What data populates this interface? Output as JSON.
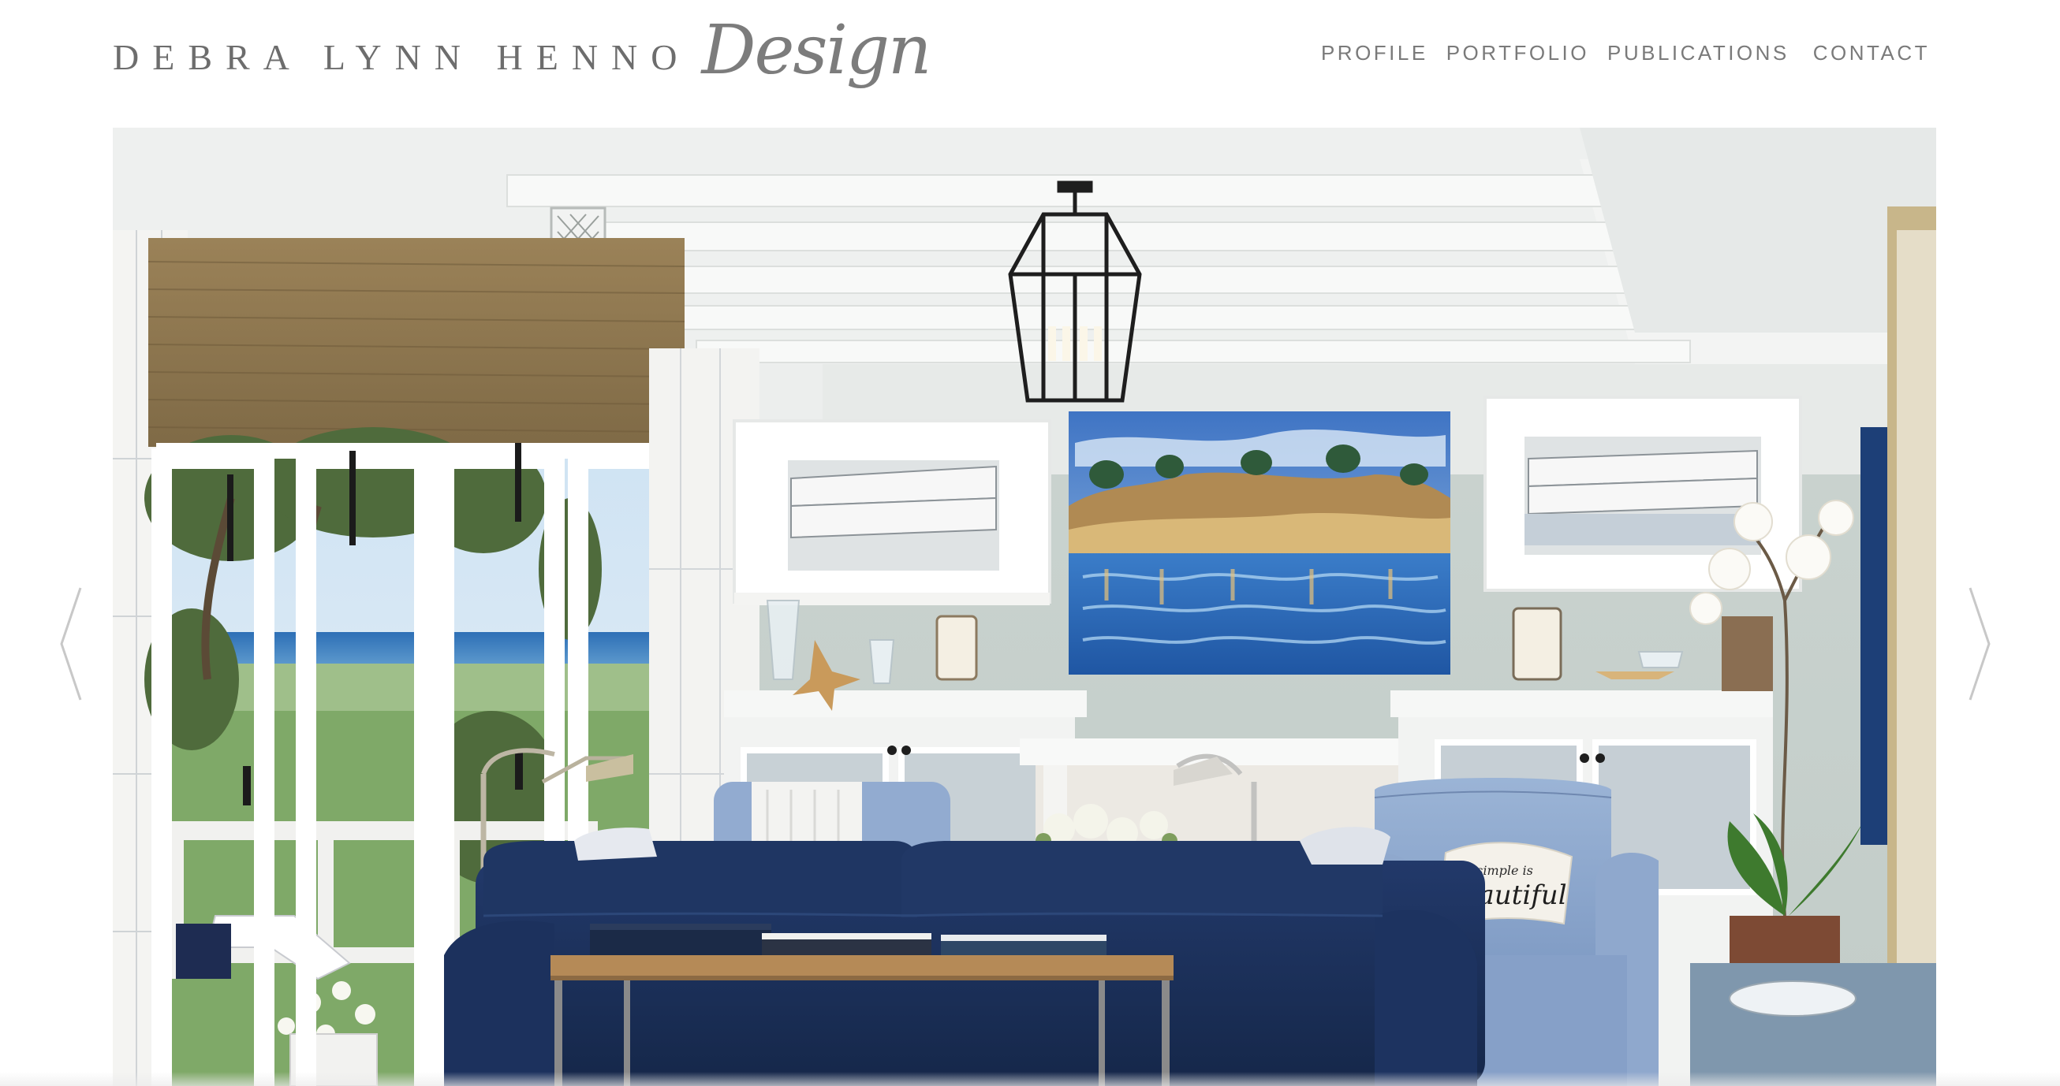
{
  "brand": {
    "name": "DEBRA LYNN HENNO",
    "script": "Design"
  },
  "nav": {
    "items": [
      {
        "label": "PROFILE"
      },
      {
        "label": "PORTFOLIO"
      },
      {
        "label": "PUBLICATIONS"
      },
      {
        "label": "CONTACT"
      }
    ]
  },
  "hero": {
    "pillow_text_top": "simple is",
    "pillow_text_main": "Beautiful"
  },
  "colors": {
    "text_gray": "#7a7a7a",
    "sofa_navy": "#1f3561",
    "wall_sage": "#c9d3cf",
    "chair_blue": "#8aa6cc"
  },
  "icons": {
    "prev": "chevron-left-icon",
    "next": "chevron-right-icon"
  }
}
